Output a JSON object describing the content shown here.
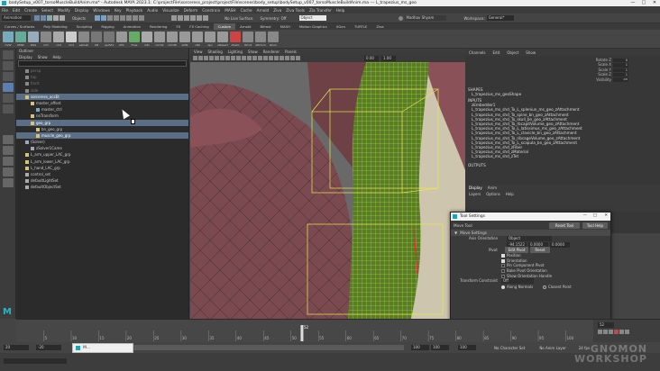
{
  "window": {
    "title": "bodySetup_v007_torsoMuscleBuildAnim.ma* - Autodesk MAYA 2023.1: C:\\projectFile\\sorceress_project\\projectFile\\scenes\\body_setup\\bodySetup_v007_torsoMuscleBuildAnim.ma --- L_trapezius_ms_geo",
    "controls": [
      "—",
      "□",
      "✕"
    ]
  },
  "menubar": [
    "File",
    "Edit",
    "Create",
    "Select",
    "Modify",
    "Display",
    "Windows",
    "Key",
    "Playback",
    "Audio",
    "Visualize",
    "Deform",
    "Constrain",
    "MASH",
    "Cache",
    "Arnold",
    "Ziva",
    "Ziva Tools",
    "Zia Transfer",
    "Help"
  ],
  "statusline": {
    "mode": "Animation",
    "objects_label": "Objects",
    "no_live_surface": "No Live Surface",
    "symmetry": "Symmetry: Off",
    "object_search": "Object",
    "user": "Madhav Shyam",
    "workspace_label": "Workspace:",
    "workspace": "General*"
  },
  "shelf": {
    "tabs": [
      "Curves / Surfaces",
      "Poly Modeling",
      "Sculpting",
      "Rigging",
      "Animation",
      "Rendering",
      "FX",
      "FX Caching",
      "Custom",
      "Arnold",
      "Bifrost",
      "MASH",
      "Motion Graphics",
      "XGen",
      "TURTLE",
      "Ziva"
    ],
    "active_tab": "Custom",
    "icons": [
      {
        "label": "CVW",
        "color": "#7ab"
      },
      {
        "label": "PMW",
        "color": "#6a9"
      },
      {
        "label": "RGS",
        "color": "#9ab"
      },
      {
        "label": "mrt",
        "color": "#888"
      },
      {
        "label": "cmt",
        "color": "#aaa"
      },
      {
        "label": "rmd",
        "color": "#ccc"
      },
      {
        "label": "setCell",
        "color": "#888"
      },
      {
        "label": "CB",
        "color": "#777"
      },
      {
        "label": "updVtx",
        "color": "#777"
      },
      {
        "label": "KFA",
        "color": "#999"
      },
      {
        "label": "Fries",
        "color": "#6a6"
      },
      {
        "label": "mtn",
        "color": "#aaa"
      },
      {
        "label": "mrmS",
        "color": "#999"
      },
      {
        "label": "mrmB",
        "color": "#999"
      },
      {
        "label": "sIVN",
        "color": "#999"
      },
      {
        "label": "cRS",
        "color": "#999"
      },
      {
        "label": "zpv",
        "color": "#999"
      },
      {
        "label": "nResert",
        "color": "#999"
      },
      {
        "label": "ofseto",
        "color": "#c44"
      },
      {
        "label": "Ofcnt",
        "color": "#888"
      },
      {
        "label": "attrCon",
        "color": "#888"
      },
      {
        "label": "leCon",
        "color": "#888"
      }
    ]
  },
  "outliner": {
    "title": "Outliner",
    "menu": [
      "Display",
      "Show",
      "Help"
    ],
    "items": [
      {
        "label": "persp",
        "indent": 1,
        "dim": true,
        "sel": false,
        "icon": "#888"
      },
      {
        "label": "top",
        "indent": 1,
        "dim": true,
        "sel": false,
        "icon": "#888"
      },
      {
        "label": "front",
        "indent": 1,
        "dim": true,
        "sel": false,
        "icon": "#888"
      },
      {
        "label": "side",
        "indent": 1,
        "dim": true,
        "sel": false,
        "icon": "#888"
      },
      {
        "label": "sorceress_accEt",
        "indent": 1,
        "dim": false,
        "sel": true,
        "icon": "#d6c27a"
      },
      {
        "label": "master_offset",
        "indent": 2,
        "dim": false,
        "sel": false,
        "icon": "#d6c27a"
      },
      {
        "label": "master_ctrl",
        "indent": 3,
        "dim": false,
        "sel": false,
        "icon": "#7ab"
      },
      {
        "label": "noTransform",
        "indent": 2,
        "dim": false,
        "sel": false,
        "icon": "#d6c27a"
      },
      {
        "label": "geo_grp",
        "indent": 2,
        "dim": false,
        "sel": true,
        "icon": "#d6c27a"
      },
      {
        "label": "bn_geo_grp",
        "indent": 3,
        "dim": false,
        "sel": false,
        "icon": "#d6c27a"
      },
      {
        "label": "muscle_geo_grp",
        "indent": 3,
        "dim": false,
        "sel": true,
        "icon": "#d6c27a"
      },
      {
        "label": "(Solver)",
        "indent": 1,
        "dim": false,
        "sel": false,
        "icon": "#9ab"
      },
      {
        "label": "zSolver1Came",
        "indent": 2,
        "dim": false,
        "sel": false,
        "icon": "#9ab"
      },
      {
        "label": "L_arm_upper_LAC_grp",
        "indent": 1,
        "dim": false,
        "sel": false,
        "icon": "#d6c27a"
      },
      {
        "label": "L_arm_lower_LAC_grp",
        "indent": 1,
        "dim": false,
        "sel": false,
        "icon": "#d6c27a"
      },
      {
        "label": "L_hand_LAC_grp",
        "indent": 1,
        "dim": false,
        "sel": false,
        "icon": "#d6c27a"
      },
      {
        "label": "control_set",
        "indent": 1,
        "dim": false,
        "sel": false,
        "icon": "#aaa"
      },
      {
        "label": "defaultLightSet",
        "indent": 1,
        "dim": false,
        "sel": false,
        "icon": "#aaa"
      },
      {
        "label": "defaultObjectSet",
        "indent": 1,
        "dim": false,
        "sel": false,
        "icon": "#aaa"
      }
    ]
  },
  "viewport": {
    "menu": [
      "View",
      "Shading",
      "Lighting",
      "Show",
      "Renderer",
      "Panels"
    ],
    "readout_1": "0.00",
    "readout_2": "1.00"
  },
  "channelbox": {
    "tabs": [
      "Channels",
      "Edit",
      "Object",
      "Show"
    ],
    "attrs": [
      {
        "label": "Rotate Z",
        "value": "0"
      },
      {
        "label": "Scale X",
        "value": "1"
      },
      {
        "label": "Scale Y",
        "value": "1"
      },
      {
        "label": "Scale Z",
        "value": "1"
      },
      {
        "label": "Visibility",
        "value": "on"
      }
    ],
    "shapes_header": "SHAPES",
    "shape": "L_trapezius_ms_geoShape",
    "inputs_header": "INPUTS",
    "inputs": [
      "zEmbedder1",
      "L_trapezius_ms_shd_To_L_spleniun_ms_geo_zAttachment",
      "L_trapezius_ms_shd_To_spine_bn_geo_zAttachment",
      "L_trapezius_ms_shd_To_skull_bn_geo_zAttachment",
      "L_trapezius_ms_shd_To_rbcapitVolume_geo_zAttachment",
      "L_trapezius_ms_shd_To_L_latissimus_ms_geo_zAttachment",
      "L_trapezius_ms_shd_To_L_clavicle_bn_geo_zAttachment",
      "L_trapezius_ms_shd_To_ribcageVolume_geo_zAttachment",
      "L_trapezius_ms_shd_To_L_scapula_bn_geo_zAttachment",
      "L_trapezius_ms_shd_zFiber",
      "L_trapezius_ms_shd_zMaterial",
      "L_trapezius_ms_shd_zTet"
    ],
    "outputs_header": "OUTPUTS"
  },
  "layers": {
    "tabs": [
      "Display",
      "Anim"
    ],
    "menu": [
      "Layers",
      "Options",
      "Help"
    ]
  },
  "tool_settings": {
    "title": "Tool Settings",
    "tool_name": "Move Tool",
    "reset_button": "Reset Tool",
    "help_button": "Tool Help",
    "section": "Move Settings",
    "axis_orientation_label": "Axis Orientation",
    "axis_orientation_value": "Object",
    "coords": [
      "-94.1522",
      "0.0000",
      "0.0000"
    ],
    "pivot_label": "Pivot",
    "edit_pivot_button": "Edit Pivot",
    "pivot_reset_button": "Reset",
    "options": [
      "Position",
      "Orientation",
      "Pin Component Pivot",
      "Bake Pivot Orientation",
      "Show Orientation Handle"
    ],
    "checked": [
      true,
      true,
      false,
      false,
      false
    ],
    "transform_constraint_label": "Transform Constraint",
    "transform_constraint_value": "Off",
    "along_normals": "Along Normals",
    "closest_point": "Closest Point"
  },
  "timeline": {
    "ticks": [
      "5",
      "10",
      "15",
      "20",
      "25",
      "30",
      "35",
      "40",
      "45",
      "50",
      "55",
      "60",
      "65",
      "70",
      "75",
      "80",
      "85",
      "90",
      "95",
      "100"
    ],
    "current_frame": "52",
    "end_field": "20"
  },
  "range": {
    "start": "20",
    "start2": "-20",
    "end": "100",
    "end2": "100",
    "end3": "100",
    "no_character_set": "No Character Set",
    "no_anim_layer": "No Anim Layer",
    "fps": "24 fps"
  },
  "taskbar_button": "M...",
  "watermark": {
    "line1": "GNOMON",
    "line2": "WORKSHOP"
  }
}
